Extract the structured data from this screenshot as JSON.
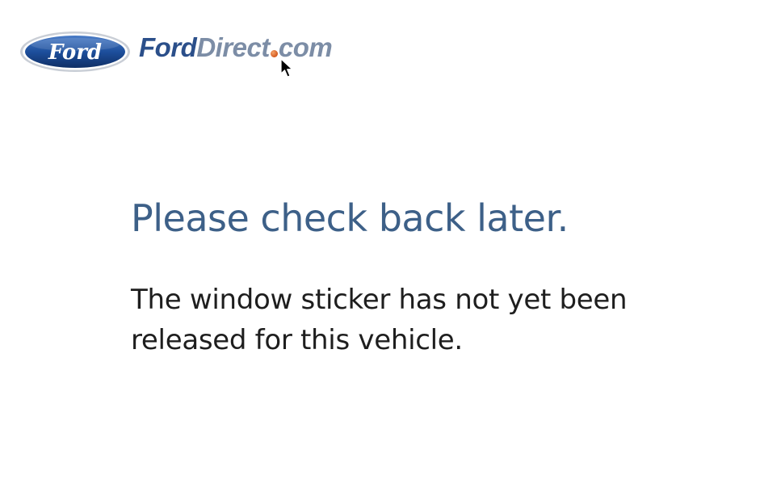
{
  "header": {
    "ford_oval_text": "Ford",
    "logo_ford": "Ford",
    "logo_direct": "Direct",
    "logo_com": "com"
  },
  "message": {
    "headline": "Please check back later.",
    "body": "The window sticker has not yet been released for this vehicle."
  },
  "colors": {
    "headline": "#3d6088",
    "body": "#1e1e1e",
    "ford_blue": "#2b4f8a",
    "logo_gray": "#7c8da6",
    "dot_orange": "#d4581c"
  },
  "icons": {
    "cursor": "mouse-pointer-icon",
    "logo": "ford-oval-logo"
  }
}
